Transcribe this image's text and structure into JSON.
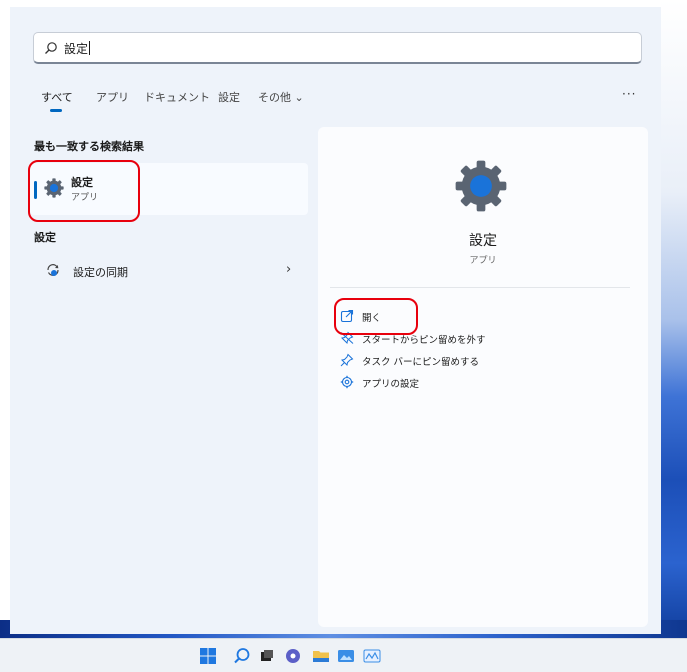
{
  "search": {
    "query": "設定"
  },
  "tabs": [
    {
      "label": "すべて",
      "active": true
    },
    {
      "label": "アプリ",
      "active": false
    },
    {
      "label": "ドキュメント",
      "active": false
    },
    {
      "label": "設定",
      "active": false
    },
    {
      "label": "その他 ⌄",
      "active": false
    }
  ],
  "more_label": "···",
  "best_match": {
    "heading": "最も一致する検索結果",
    "name": "設定",
    "type": "アプリ",
    "icon": "gear-icon"
  },
  "settings_section": {
    "heading": "設定",
    "items": [
      {
        "label": "設定の同期",
        "icon": "sync-icon",
        "chevron": "›"
      }
    ]
  },
  "preview": {
    "title": "設定",
    "subtitle": "アプリ",
    "icon": "gear-icon",
    "actions": [
      {
        "label": "開く",
        "icon": "open-icon"
      },
      {
        "label": "スタートからピン留めを外す",
        "icon": "unpin-icon"
      },
      {
        "label": "タスク バーにピン留めする",
        "icon": "pin-icon"
      },
      {
        "label": "アプリの設定",
        "icon": "gear-icon"
      }
    ]
  },
  "taskbar": {
    "icons": [
      "windows-start-icon",
      "search-icon",
      "task-view-icon",
      "chat-icon",
      "file-explorer-icon",
      "photos-icon",
      "app-icon"
    ]
  },
  "colors": {
    "accent": "#0067c0",
    "highlight": "#e8000d",
    "panel": "#eef3fa"
  }
}
